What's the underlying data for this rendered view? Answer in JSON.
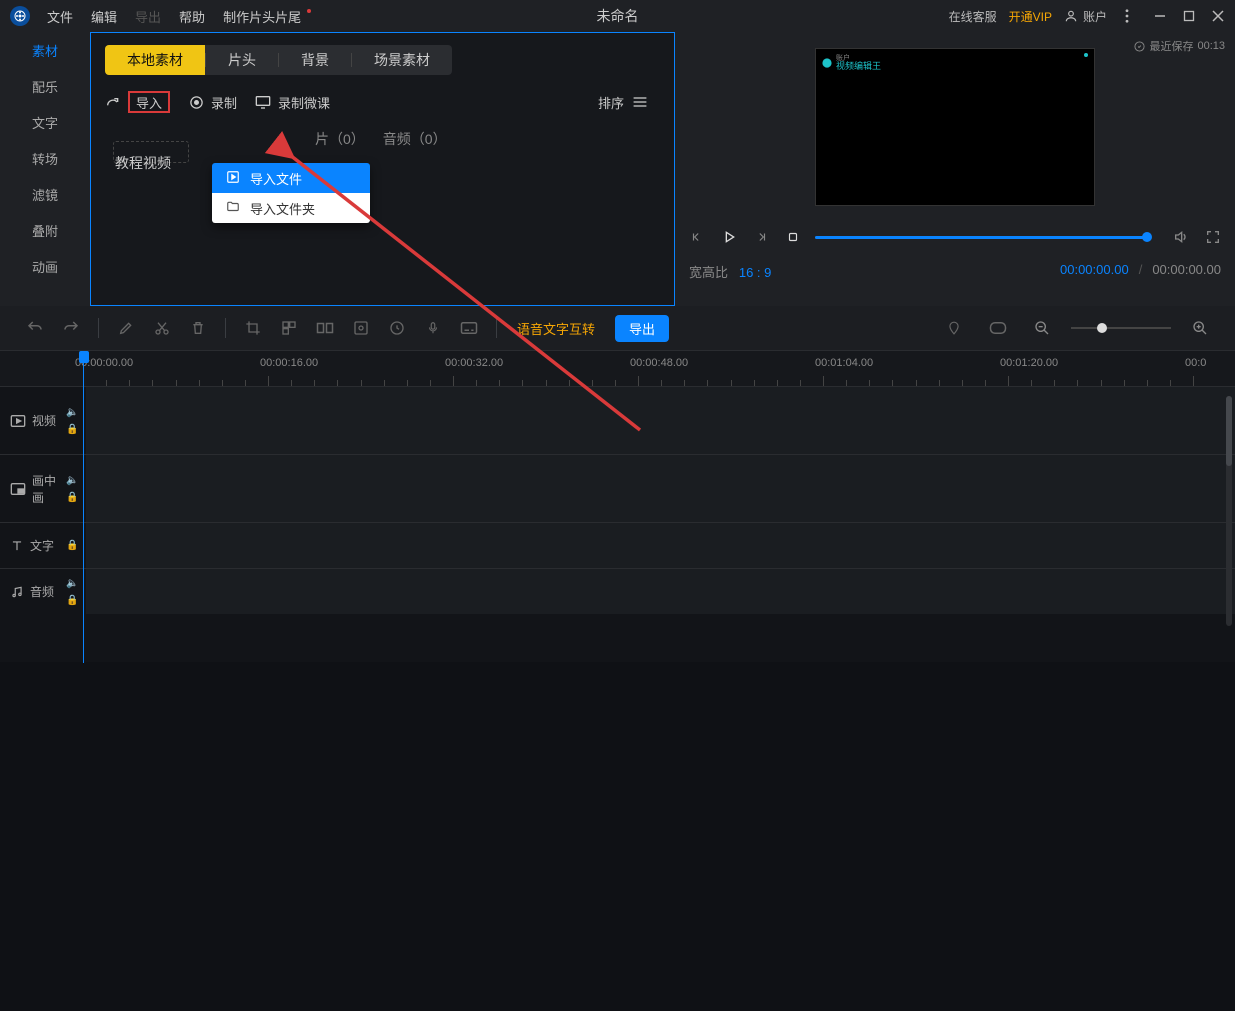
{
  "topbar": {
    "menus": [
      "文件",
      "编辑",
      "导出",
      "帮助",
      "制作片头片尾"
    ],
    "title": "未命名",
    "online_service": "在线客服",
    "vip": "开通VIP",
    "account": "账户"
  },
  "sidetabs": [
    "素材",
    "配乐",
    "文字",
    "转场",
    "滤镜",
    "叠附",
    "动画"
  ],
  "subtabs": [
    "本地素材",
    "片头",
    "背景",
    "场景素材"
  ],
  "actions": {
    "import": "导入",
    "record": "录制",
    "micro": "录制微课",
    "sort": "排序"
  },
  "dropdown": {
    "import_file": "导入文件",
    "import_folder": "导入文件夹"
  },
  "counts": {
    "clip": "片（0）",
    "audio": "音频（0）"
  },
  "tutorial_label": "教程视频",
  "preview": {
    "save_label": "最近保存",
    "save_time": "00:13",
    "watermark": "视频编辑王",
    "account_hint": "账户",
    "aspect_label": "宽高比",
    "aspect_value": "16 : 9",
    "time_cur": "00:00:00.00",
    "time_total": "00:00:00.00"
  },
  "toolstrip": {
    "voice": "语音文字互转",
    "export": "导出"
  },
  "ruler_labels": [
    "00:00:00.00",
    "00:00:16.00",
    "00:00:32.00",
    "00:00:48.00",
    "00:01:04.00",
    "00:01:20.00",
    "00:0"
  ],
  "tracks": {
    "video": "视频",
    "pip": "画中画",
    "text": "文字",
    "audio": "音频"
  }
}
